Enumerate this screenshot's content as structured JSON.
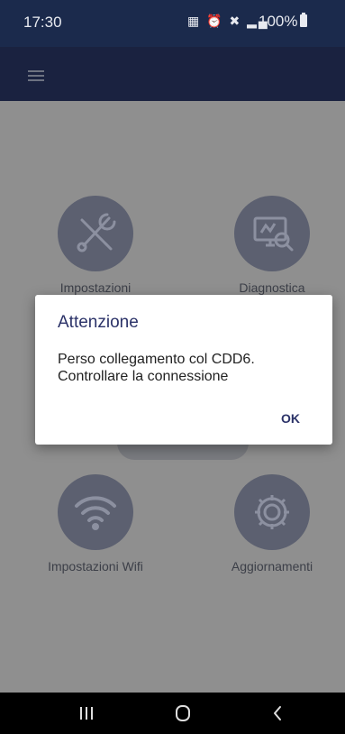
{
  "status_bar": {
    "time": "17:30",
    "battery": "100%",
    "icons": [
      "notification-icon",
      "alarm-icon",
      "mute-icon",
      "signal-icon",
      "battery-icon"
    ]
  },
  "app_bar": {
    "menu_icon": "hamburger-menu-icon"
  },
  "tiles": [
    {
      "label": "Impostazioni",
      "icon": "tools-icon"
    },
    {
      "label": "Diagnostica",
      "icon": "diagnostics-monitor-icon"
    },
    {
      "label": "Impostazioni Wifi",
      "icon": "wifi-icon"
    },
    {
      "label": "Aggiornamenti",
      "icon": "gear-icon"
    }
  ],
  "dialog": {
    "title": "Attenzione",
    "message": "Perso collegamento col CDD6. Controllare la connessione",
    "ok_label": "OK"
  },
  "nav_bar": {
    "buttons": [
      "recent-apps-icon",
      "home-icon",
      "back-icon"
    ]
  },
  "colors": {
    "status_bar": "#1b2a4c",
    "app_bar": "#1a2240",
    "overlay_bg": "#8f8f8f",
    "tile_circle": "#5c6070",
    "accent": "#2b3268"
  }
}
